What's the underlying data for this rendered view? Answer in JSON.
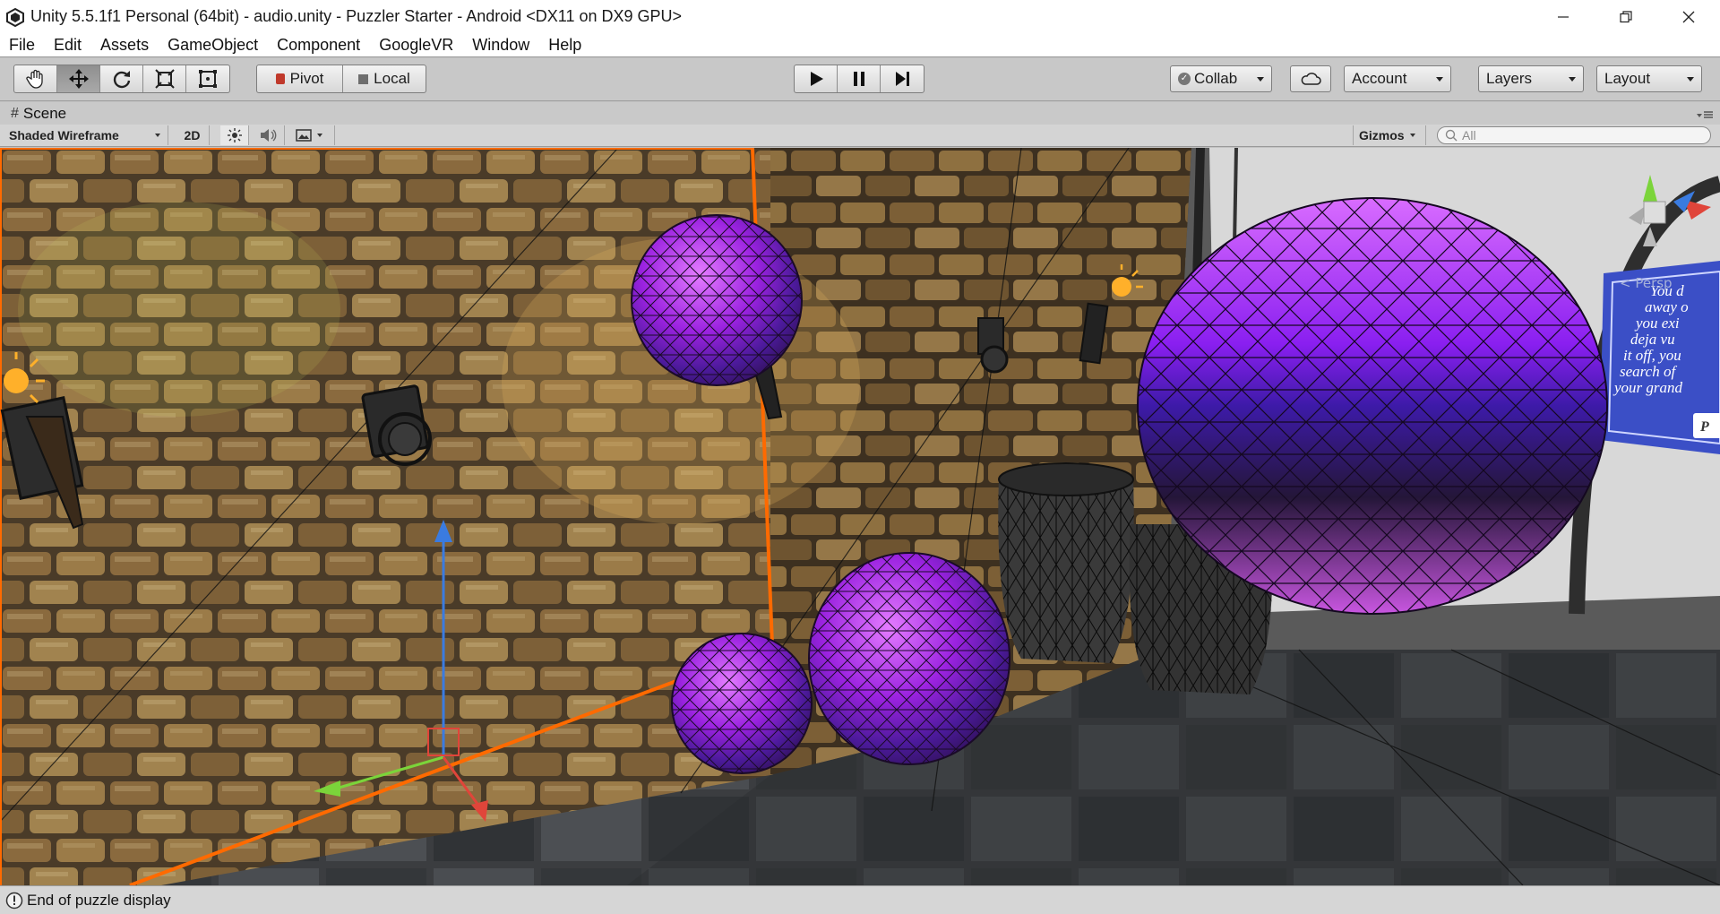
{
  "window": {
    "title": "Unity 5.5.1f1 Personal (64bit) - audio.unity - Puzzler Starter - Android <DX11 on DX9 GPU>"
  },
  "menu": [
    "File",
    "Edit",
    "Assets",
    "GameObject",
    "Component",
    "GoogleVR",
    "Window",
    "Help"
  ],
  "toolbar": {
    "pivot_label": "Pivot",
    "local_label": "Local",
    "collab_label": "Collab",
    "account_label": "Account",
    "layers_label": "Layers",
    "layout_label": "Layout"
  },
  "scene": {
    "tab_label": "Scene",
    "shading_mode": "Shaded Wireframe",
    "mode_2d": "2D",
    "gizmos_label": "Gizmos",
    "search_placeholder": "All",
    "persp_label": "< Persp",
    "sign_text": [
      "You d",
      "away o",
      "you exi",
      "deja vu",
      "it off, you",
      "search of",
      "your grand"
    ],
    "sign_button": "P"
  },
  "status": {
    "message": "End of puzzle display"
  },
  "colors": {
    "accent_orange": "#ff6a00",
    "sphere_purple": "#a020f0",
    "sign_blue": "#3b4fc6"
  }
}
